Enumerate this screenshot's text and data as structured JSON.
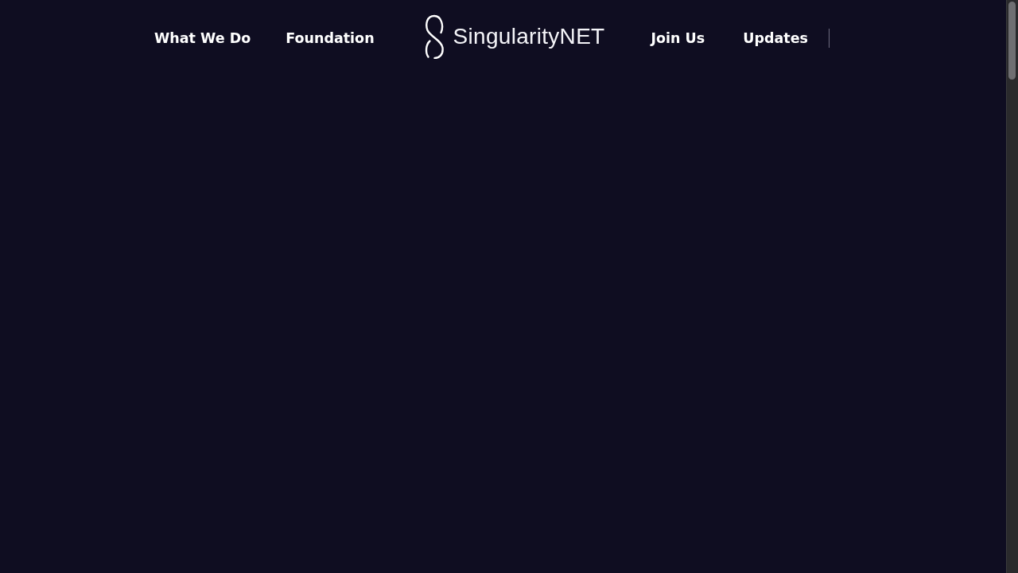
{
  "nav": {
    "left_links": [
      {
        "label": "What We Do"
      },
      {
        "label": "Foundation"
      }
    ],
    "logo": {
      "text": "SingularityNET"
    },
    "right_links": [
      {
        "label": "Join Us"
      },
      {
        "label": "Updates"
      }
    ]
  }
}
